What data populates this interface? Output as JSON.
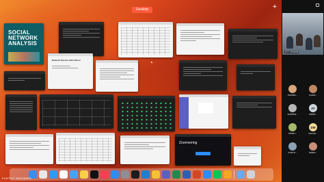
{
  "mission_control": {
    "space_label": "Desktop",
    "add_space_symbol": "+"
  },
  "windows": {
    "sna": {
      "title_line1": "SOCIAL",
      "title_line2": "NETWORK",
      "title_line3": "ANALYSIS"
    },
    "notebook": {
      "title": "Network Science with Python"
    },
    "installer": {
      "title": "Zoomvering"
    }
  },
  "presenter": {
    "name": "KUNTHIT WATANAPA"
  },
  "video": {
    "main_tile_name": "ICT CR2008",
    "participants": [
      {
        "initials": "",
        "name": "PHUMIN...",
        "color": "#d9a679"
      },
      {
        "initials": "",
        "name": "CHANI...",
        "color": "#c08862"
      },
      {
        "initials": "",
        "name": "SUPPAW...",
        "color": "#b7b7b7"
      },
      {
        "initials": "AY",
        "name": "SIRIRY...",
        "color": "#cdd5de"
      },
      {
        "initials": "",
        "name": "TANPH...",
        "color": "#a8b86a"
      },
      {
        "initials": "DM",
        "name": "DACHA...",
        "color": "#f3d99a"
      },
      {
        "initials": "",
        "name": "KUNTH...",
        "color": "#8aa0b5"
      },
      {
        "initials": "",
        "name": "NARIN...",
        "color": "#c98f7a"
      }
    ]
  },
  "dock": {
    "icons": [
      {
        "name": "finder-icon",
        "color": "#3a8ef0"
      },
      {
        "name": "launchpad-icon",
        "color": "#e8e8e8"
      },
      {
        "name": "safari-icon",
        "color": "#2f9bf0"
      },
      {
        "name": "calendar-icon",
        "color": "#ffffff"
      },
      {
        "name": "mail-icon",
        "color": "#4aa2f7"
      },
      {
        "name": "notes-icon",
        "color": "#f6d049"
      },
      {
        "name": "tv-icon",
        "color": "#111111"
      },
      {
        "name": "music-icon",
        "color": "#fa3c55"
      },
      {
        "name": "appstore-icon",
        "color": "#2e8df3"
      },
      {
        "name": "settings-icon",
        "color": "#8e8e93"
      },
      {
        "name": "terminal-icon",
        "color": "#1c1c1c"
      },
      {
        "name": "vscode-icon",
        "color": "#1f7fd1"
      },
      {
        "name": "chrome-icon",
        "color": "#f2c232"
      },
      {
        "name": "teams-icon",
        "color": "#5b5fc7"
      },
      {
        "name": "excel-icon",
        "color": "#1f8a4d"
      },
      {
        "name": "word-icon",
        "color": "#2b5fb5"
      },
      {
        "name": "powerpoint-icon",
        "color": "#d24726"
      },
      {
        "name": "zoom-icon",
        "color": "#2d8cff"
      },
      {
        "name": "line-icon",
        "color": "#06c755"
      },
      {
        "name": "photos-icon",
        "color": "#f5a623"
      }
    ],
    "trailing_icons": [
      {
        "name": "downloads-icon",
        "color": "#6aa8ef"
      },
      {
        "name": "trash-icon",
        "color": "#cfd3d8"
      }
    ]
  }
}
